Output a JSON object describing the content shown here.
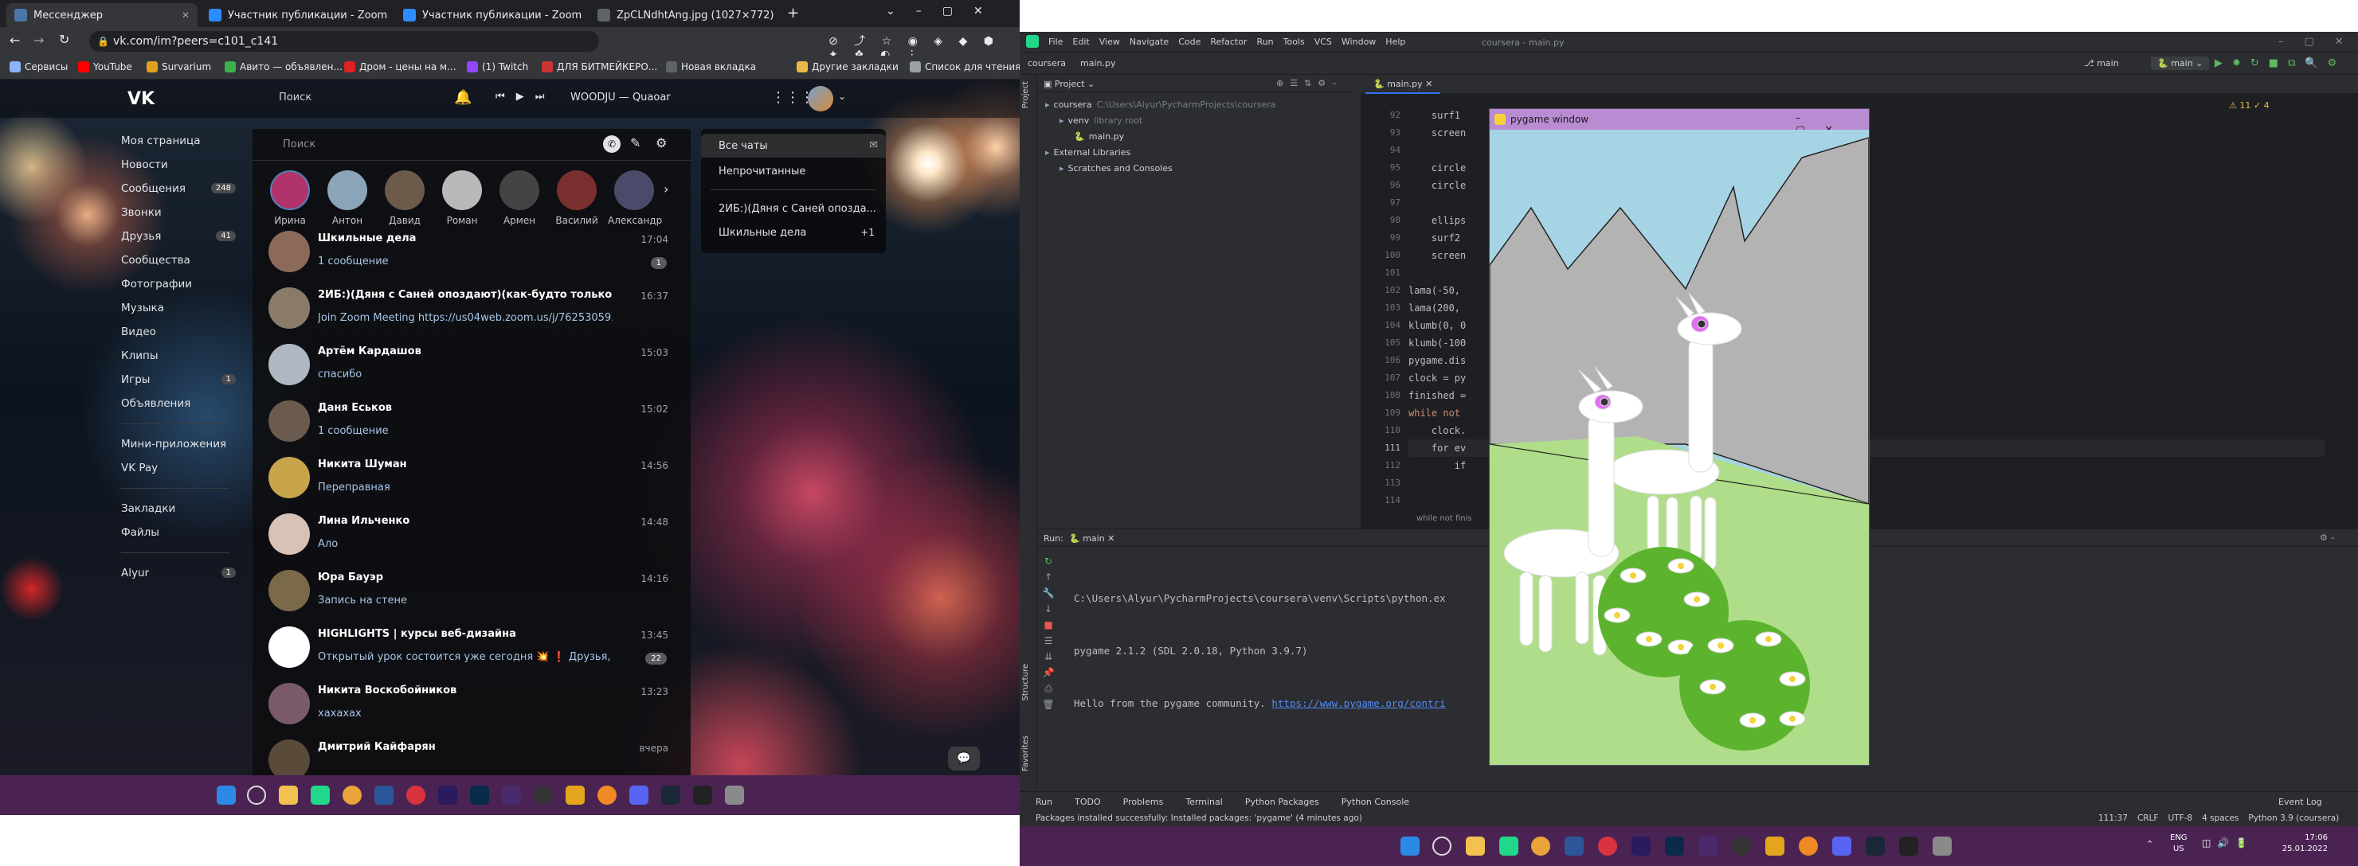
{
  "browser": {
    "tabs": [
      {
        "label": "Мессенджер",
        "color": "#4a76a8"
      },
      {
        "label": "Участник публикации - Zoom",
        "color": "#2d8cff"
      },
      {
        "label": "Участник публикации - Zoom",
        "color": "#2d8cff"
      },
      {
        "label": "ZpCLNdhtAng.jpg (1027×772)",
        "color": "#5f6368"
      }
    ],
    "new_tab": "+",
    "url": "vk.com/im?peers=c101_c141",
    "bookmarks": [
      "Сервисы",
      "YouTube",
      "Survarium",
      "Авито — объявлен...",
      "Дром - цены на м...",
      "(1) Twitch",
      "ДЛЯ БИТМЕЙКЕРО...",
      "Новая вкладка"
    ],
    "bookmark_folders": [
      "Другие закладки",
      "Список для чтения"
    ]
  },
  "vk": {
    "search_placeholder": "Поиск",
    "now_playing": "WOODJU — Quaoar",
    "nav": [
      {
        "label": "Моя страница",
        "count": ""
      },
      {
        "label": "Новости",
        "count": ""
      },
      {
        "label": "Сообщения",
        "count": "248"
      },
      {
        "label": "Звонки",
        "count": ""
      },
      {
        "label": "Друзья",
        "count": "41"
      },
      {
        "label": "Сообщества",
        "count": ""
      },
      {
        "label": "Фотографии",
        "count": ""
      },
      {
        "label": "Музыка",
        "count": ""
      },
      {
        "label": "Видео",
        "count": ""
      },
      {
        "label": "Клипы",
        "count": ""
      },
      {
        "label": "Игры",
        "count": "1"
      },
      {
        "label": "Объявления",
        "count": ""
      }
    ],
    "nav2": [
      "Мини-приложения",
      "VK Pay"
    ],
    "nav3": [
      "Закладки",
      "Файлы"
    ],
    "nav_user": {
      "label": "Alyur",
      "count": "1"
    },
    "chat_search_placeholder": "Поиск",
    "stories": [
      {
        "name": "Ирина",
        "color": "#b0346b"
      },
      {
        "name": "Антон",
        "color": "#8aa5b8"
      },
      {
        "name": "Давид",
        "color": "#6c5a4a"
      },
      {
        "name": "Роман",
        "color": "#b9b9b9"
      },
      {
        "name": "Армен",
        "color": "#444"
      },
      {
        "name": "Василий",
        "color": "#7a2f2f"
      },
      {
        "name": "Александр",
        "color": "#4c4a6a"
      }
    ],
    "chats": [
      {
        "title": "Шкильные дела",
        "preview": "1 сообщение",
        "time": "17:04",
        "badge": "1",
        "color": "#8c6a5a"
      },
      {
        "title": "2ИБ:)(Дяня с Саней опоздают)(как-будто только мы ...",
        "preview": "Join Zoom Meeting https://us04web.zoom.us/j/76253059...",
        "time": "16:37",
        "badge": "",
        "color": "#8a7a6a"
      },
      {
        "title": "Артём Кардашов",
        "preview": "спасибо",
        "time": "15:03",
        "badge": "",
        "color": "#aeb7c2"
      },
      {
        "title": "Даня Еськов",
        "preview": "1 сообщение",
        "time": "15:02",
        "badge": "",
        "color": "#6b5a4e"
      },
      {
        "title": "Никита Шуман",
        "preview": "Переправная",
        "time": "14:56",
        "badge": "",
        "color": "#c8a44a"
      },
      {
        "title": "Лина Ильченко",
        "preview": "Ало",
        "time": "14:48",
        "badge": "",
        "color": "#d8c2b6"
      },
      {
        "title": "Юра Бауэр",
        "preview": "Запись на стене",
        "time": "14:16",
        "badge": "",
        "color": "#7a6a4a"
      },
      {
        "title": "HIGHLIGHTS | курсы веб-дизайна",
        "preview": "Открытый урок состоится уже сегодня 💥 ❗ Друзья, открыт...",
        "time": "13:45",
        "badge": "22",
        "color": "#ffffff"
      },
      {
        "title": "Никита Воскобойников",
        "preview": "хахахах",
        "time": "13:23",
        "badge": "",
        "color": "#7a5a6a"
      },
      {
        "title": "Дмитрий Кайфарян",
        "preview": "",
        "time": "вчера",
        "badge": "",
        "color": "#5a4a3a"
      }
    ],
    "folders": [
      {
        "label": "Все чаты",
        "count": ""
      },
      {
        "label": "Непрочитанные",
        "count": ""
      },
      {
        "label": "2ИБ:)(Дяня с Саней опозда...",
        "count": ""
      },
      {
        "label": "Шкильные дела",
        "count": "+1"
      }
    ]
  },
  "pycharm": {
    "menu": [
      "File",
      "Edit",
      "View",
      "Navigate",
      "Code",
      "Refactor",
      "Run",
      "Tools",
      "VCS",
      "Window",
      "Help"
    ],
    "window_title": "coursera - main.py",
    "breadcrumb": [
      "coursera",
      "main.py"
    ],
    "branch": "main",
    "run_config": "main",
    "project_label": "Project",
    "tree": [
      {
        "label": "coursera",
        "hint": "C:\\Users\\Alyur\\PycharmProjects\\coursera",
        "indent": 0
      },
      {
        "label": "venv",
        "hint": "library root",
        "indent": 1
      },
      {
        "label": "main.py",
        "hint": "",
        "indent": 2
      },
      {
        "label": "External Libraries",
        "hint": "",
        "indent": 0
      },
      {
        "label": "Scratches and Consoles",
        "hint": "",
        "indent": 1
      }
    ],
    "editor_tab": "main.py",
    "warnings": "⚠ 11  ✓ 4",
    "code_lines": [
      {
        "n": "92",
        "t": "    surf1"
      },
      {
        "n": "93",
        "t": "    screen"
      },
      {
        "n": "94",
        "t": ""
      },
      {
        "n": "95",
        "t": "    circle"
      },
      {
        "n": "96",
        "t": "    circle"
      },
      {
        "n": "97",
        "t": ""
      },
      {
        "n": "98",
        "t": "    ellips"
      },
      {
        "n": "99",
        "t": "    surf2"
      },
      {
        "n": "100",
        "t": "    screen"
      },
      {
        "n": "101",
        "t": ""
      },
      {
        "n": "102",
        "t": "lama(-50,"
      },
      {
        "n": "103",
        "t": "lama(200,"
      },
      {
        "n": "104",
        "t": "klumb(0, 0"
      },
      {
        "n": "105",
        "t": "klumb(-100"
      },
      {
        "n": "106",
        "t": "pygame.dis"
      },
      {
        "n": "107",
        "t": "clock = py"
      },
      {
        "n": "108",
        "t": "finished ="
      },
      {
        "n": "109",
        "t": "while not"
      },
      {
        "n": "110",
        "t": "    clock."
      },
      {
        "n": "111",
        "t": "    for ev"
      },
      {
        "n": "112",
        "t": "        if"
      },
      {
        "n": "113",
        "t": ""
      },
      {
        "n": "114",
        "t": ""
      }
    ],
    "code_breadcrumb": "while not finis",
    "run_label": "Run:",
    "run_tab": "main",
    "console": [
      "C:\\Users\\Alyur\\PycharmProjects\\coursera\\venv\\Scripts\\python.ex",
      "pygame 2.1.2 (SDL 2.0.18, Python 3.9.7)",
      "Hello from the pygame community. "
    ],
    "console_link": "https://www.pygame.org/contri",
    "bottom_tabs": [
      "Run",
      "TODO",
      "Problems",
      "Terminal",
      "Python Packages",
      "Python Console"
    ],
    "event_log": "Event Log",
    "status_msg": "Packages installed successfully: Installed packages: 'pygame' (4 minutes ago)",
    "status_right": [
      "111:37",
      "CRLF",
      "UTF-8",
      "4 spaces",
      "Python 3.9 (coursera)"
    ],
    "side_labels": [
      "Structure",
      "Favorites"
    ],
    "pygame_title": "pygame window"
  },
  "tray": {
    "lang1": "ENG",
    "lang2": "US",
    "time": "17:06",
    "date": "25.01.2022"
  }
}
